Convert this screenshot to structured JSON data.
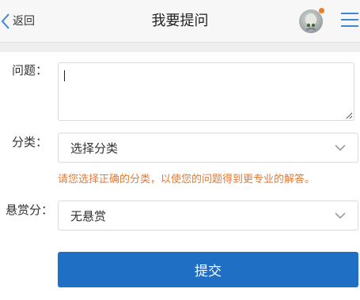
{
  "header": {
    "back_label": "返回",
    "title": "我要提问"
  },
  "form": {
    "question_label": "问题：",
    "question_value": "",
    "category_label": "分类：",
    "category_selected": "选择分类",
    "category_hint": "请您选择正确的分类，以使您的问题得到更专业的解答。",
    "reward_label": "悬赏分：",
    "reward_selected": "无悬赏",
    "submit_label": "提交"
  },
  "colors": {
    "accent": "#1f6fc5",
    "menu_icon": "#3f86d8",
    "hint_text": "#e07a36",
    "notification_dot": "#f07b1e"
  },
  "icons": {
    "back": "chevron-left-icon",
    "menu": "hamburger-menu-icon",
    "dropdown": "chevron-down-icon"
  }
}
